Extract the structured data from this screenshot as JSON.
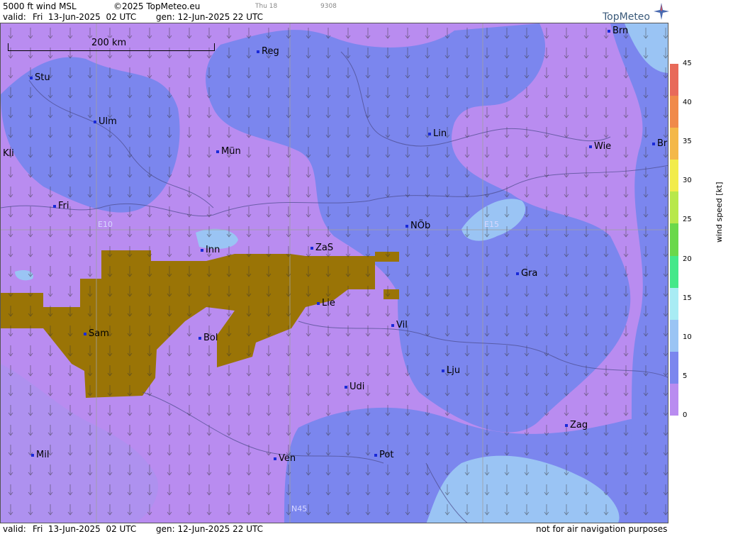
{
  "header": {
    "title": "5000 ft wind MSL",
    "copyright": "©2025 TopMeteo.eu",
    "valid_label": "valid:",
    "valid": "Fri  13-Jun-2025  02 UTC",
    "gen": "gen: 12-Jun-2025 22 UTC",
    "faint1": "Thu 18",
    "faint2": "9308"
  },
  "logo": {
    "text": "TopMeteo"
  },
  "scale": {
    "label": "200 km"
  },
  "grid_labels": [
    "E10",
    "E15",
    "N45"
  ],
  "cities": [
    "Brn",
    "Reg",
    "Stu",
    "Ulm",
    "Kli",
    "Mün",
    "Lin",
    "Wie",
    "Br",
    "Fri",
    "NÖb",
    "Inn",
    "ZaS",
    "Gra",
    "Lie",
    "Vil",
    "Sam",
    "Bol",
    "Lju",
    "Udi",
    "Zag",
    "Mil",
    "Ven",
    "Pot"
  ],
  "legend": {
    "unit": "wind  speed  [kt]",
    "ticks": [
      "45",
      "40",
      "35",
      "30",
      "25",
      "20",
      "15",
      "10",
      "5",
      "0"
    ],
    "colors": [
      "#e86a5a",
      "#f08a4a",
      "#f4b848",
      "#f2ec4a",
      "#b8e84a",
      "#6ad84a",
      "#44e88a",
      "#a8ecf4",
      "#9ac4f4",
      "#7b86ee",
      "#b98cf0"
    ]
  },
  "colors": {
    "terrain": "#9a7406",
    "slow": "#b98cf0",
    "mid": "#7b86ee",
    "fast": "#9ac4f4",
    "faster": "#a8ecf4"
  },
  "footer": {
    "valid_label": "valid:",
    "valid": "Fri  13-Jun-2025  02 UTC",
    "gen": "gen: 12-Jun-2025 22 UTC",
    "disclaimer": "not for air navigation purposes"
  }
}
